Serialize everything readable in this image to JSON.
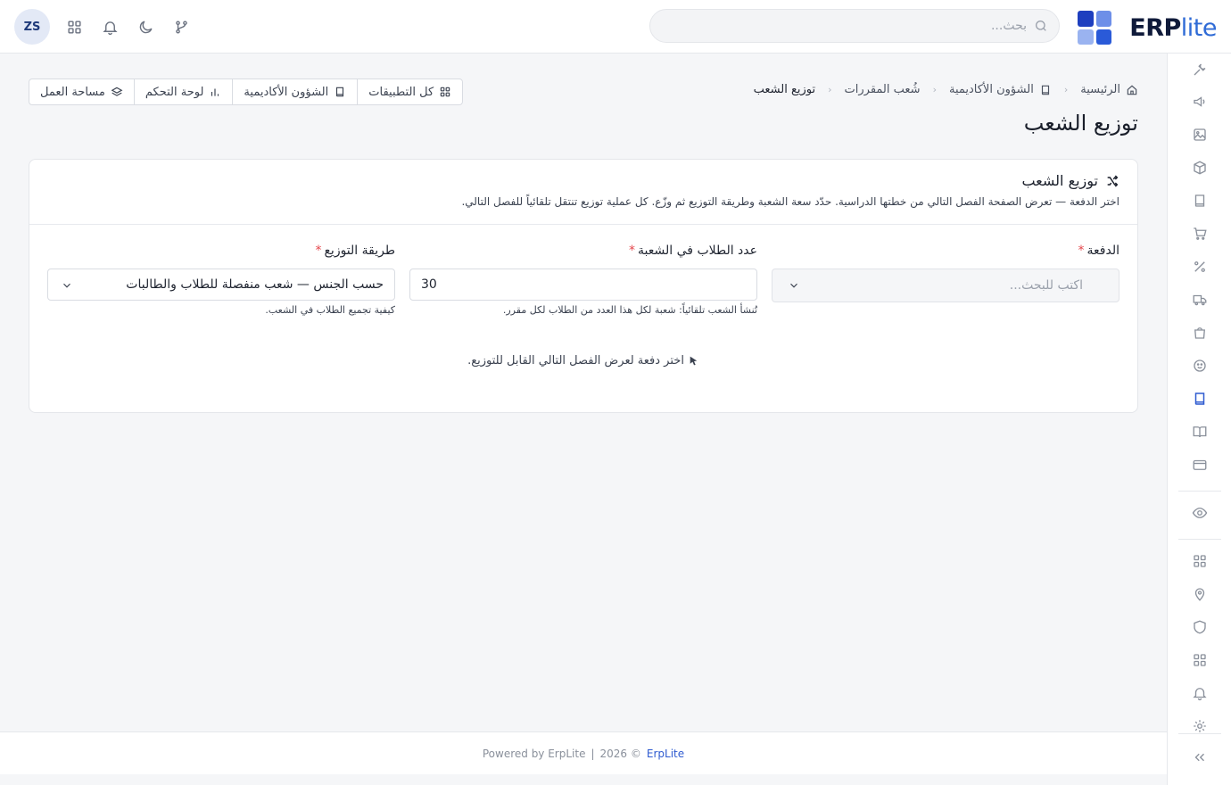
{
  "brand": {
    "logo_bold": "ERP",
    "logo_light": "lite",
    "colors": {
      "mark1": "#1e3fbf",
      "mark2": "#6d8fe8",
      "mark3": "#9ab3f0",
      "mark4": "#2a5ad8"
    }
  },
  "header": {
    "search_placeholder": "بحث...",
    "avatar_initials": "ZS",
    "icons": [
      "git-branch-icon",
      "moon-icon",
      "bell-icon",
      "apps-grid-icon"
    ]
  },
  "breadcrumb": {
    "items": [
      "الرئيسية",
      "الشؤون الأكاديمية",
      "شُعب المقررات"
    ],
    "current": "توزيع الشعب"
  },
  "quicklinks": {
    "workspace": "مساحة العمل",
    "dashboard": "لوحة التحكم",
    "academic": "الشؤون الأكاديمية",
    "all_apps": "كل التطبيقات"
  },
  "page": {
    "title": "توزيع الشعب"
  },
  "card": {
    "title": "توزيع الشعب",
    "description": "اختر الدفعة — تعرض الصفحة الفصل التالي من خطتها الدراسية. حدّد سعة الشعبة وطريقة التوزيع ثم وزّع. كل عملية توزيع تنتقل تلقائياً للفصل التالي."
  },
  "form": {
    "batch": {
      "label": "الدفعة",
      "required_mark": "*",
      "placeholder": "اكتب للبحث..."
    },
    "students_per_section": {
      "label": "عدد الطلاب في الشعبة",
      "required_mark": "*",
      "value": "30",
      "hint": "تُنشأ الشعب تلقائياً: شعبة لكل هذا العدد من الطلاب لكل مقرر."
    },
    "method": {
      "label": "طريقة التوزيع",
      "required_mark": "*",
      "value": "حسب الجنس — شعب منفصلة للطلاب والطالبات",
      "hint": "كيفية تجميع الطلاب في الشعب."
    }
  },
  "empty_state": {
    "text": "اختر دفعة لعرض الفصل التالي القابل للتوزيع."
  },
  "footer": {
    "powered": "Powered by ErpLite",
    "sep": "|",
    "year": "2026 ©",
    "brand": "ErpLite"
  },
  "sidebar": {
    "items": [
      "tools-icon",
      "megaphone-icon",
      "image-icon",
      "box-icon",
      "book-icon",
      "cart-icon",
      "percent-icon",
      "truck-icon",
      "shopping-bag-icon",
      "smile-icon",
      "notebook-icon",
      "open-book-icon",
      "credit-card-icon",
      "eye-icon",
      "grid-icon",
      "location-icon",
      "shield-icon",
      "grid-icon",
      "bell-icon",
      "settings-icon",
      "collapse-icon"
    ],
    "active": "notebook-icon"
  }
}
